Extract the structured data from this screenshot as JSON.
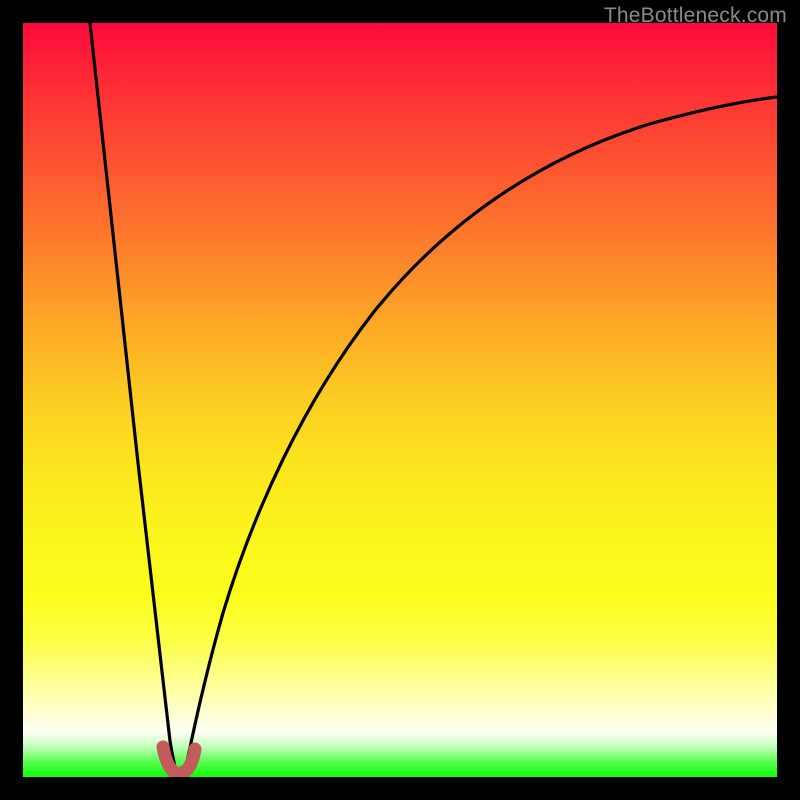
{
  "watermark": {
    "text": "TheBottleneck.com"
  },
  "colors": {
    "frame": "#000000",
    "curve": "#000000",
    "u_shape": "#c25b5b",
    "watermark": "#8b8b8b",
    "gradient_top": "#fe093a",
    "gradient_bottom": "#0ffd07"
  },
  "chart_data": {
    "type": "line",
    "title": "",
    "xlabel": "",
    "ylabel": "",
    "xlim": [
      0,
      100
    ],
    "ylim": [
      0,
      100
    ],
    "grid": false,
    "legend": false,
    "series": [
      {
        "name": "left-branch",
        "x": [
          9,
          10,
          11,
          12,
          13,
          14,
          15,
          16,
          17,
          18,
          19,
          19.5
        ],
        "values": [
          100,
          90,
          80,
          70,
          60,
          50,
          40,
          30,
          20,
          12,
          5,
          2
        ]
      },
      {
        "name": "right-branch",
        "x": [
          21.5,
          23,
          25,
          28,
          32,
          37,
          43,
          50,
          58,
          67,
          77,
          88,
          100
        ],
        "values": [
          2,
          8,
          16,
          25,
          35,
          45,
          55,
          63,
          70,
          76,
          81,
          85,
          88
        ]
      }
    ],
    "annotation": {
      "name": "u-minimum",
      "x_range": [
        18.5,
        22.3
      ],
      "y_range": [
        0,
        4
      ],
      "color": "#c25b5b"
    }
  }
}
